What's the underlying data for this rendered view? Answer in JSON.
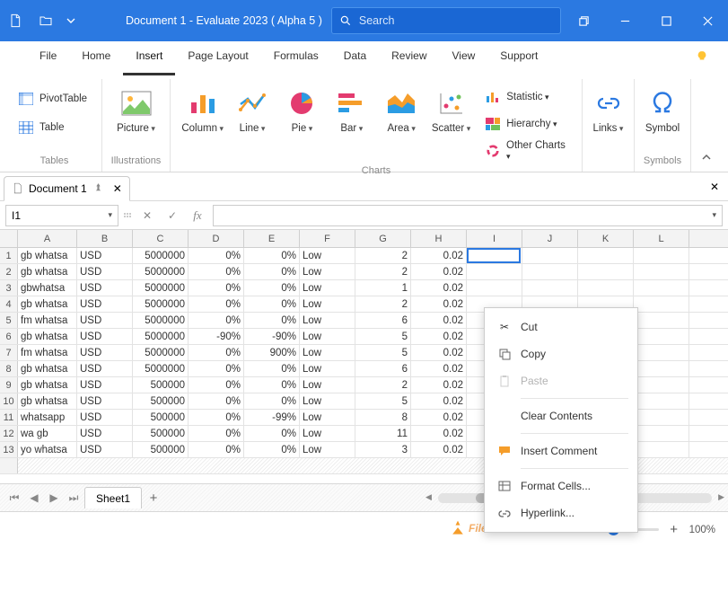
{
  "titlebar": {
    "document_title": "Document 1 - Evaluate 2023 ( Alpha 5 )",
    "search_placeholder": "Search"
  },
  "menu": {
    "tabs": [
      "File",
      "Home",
      "Insert",
      "Page Layout",
      "Formulas",
      "Data",
      "Review",
      "View",
      "Support"
    ],
    "active": "Insert"
  },
  "ribbon": {
    "tables": {
      "label": "Tables",
      "pivot": "PivotTable",
      "table": "Table"
    },
    "illustrations": {
      "label": "Illustrations",
      "picture": "Picture"
    },
    "charts": {
      "label": "Charts",
      "column": "Column",
      "line": "Line",
      "pie": "Pie",
      "bar": "Bar",
      "area": "Area",
      "scatter": "Scatter",
      "statistic": "Statistic",
      "hierarchy": "Hierarchy",
      "other": "Other Charts"
    },
    "links": {
      "label": "",
      "links": "Links"
    },
    "symbols": {
      "label": "Symbols",
      "symbol": "Symbol"
    }
  },
  "doctab": {
    "name": "Document 1"
  },
  "formula": {
    "cellref": "I1"
  },
  "grid": {
    "cols": [
      "A",
      "B",
      "C",
      "D",
      "E",
      "F",
      "G",
      "H",
      "I",
      "J",
      "K",
      "L"
    ],
    "rows": [
      {
        "n": "1",
        "A": "gb whatsa",
        "B": "USD",
        "C": "5000000",
        "D": "0%",
        "E": "0%",
        "F": "Low",
        "G": "2",
        "H": "0.02"
      },
      {
        "n": "2",
        "A": "gb whatsa",
        "B": "USD",
        "C": "5000000",
        "D": "0%",
        "E": "0%",
        "F": "Low",
        "G": "2",
        "H": "0.02"
      },
      {
        "n": "3",
        "A": "gbwhatsa",
        "B": "USD",
        "C": "5000000",
        "D": "0%",
        "E": "0%",
        "F": "Low",
        "G": "1",
        "H": "0.02"
      },
      {
        "n": "4",
        "A": "gb whatsa",
        "B": "USD",
        "C": "5000000",
        "D": "0%",
        "E": "0%",
        "F": "Low",
        "G": "2",
        "H": "0.02"
      },
      {
        "n": "5",
        "A": "fm whatsa",
        "B": "USD",
        "C": "5000000",
        "D": "0%",
        "E": "0%",
        "F": "Low",
        "G": "6",
        "H": "0.02"
      },
      {
        "n": "6",
        "A": "gb whatsa",
        "B": "USD",
        "C": "5000000",
        "D": "-90%",
        "E": "-90%",
        "F": "Low",
        "G": "5",
        "H": "0.02"
      },
      {
        "n": "7",
        "A": "fm whatsa",
        "B": "USD",
        "C": "5000000",
        "D": "0%",
        "E": "900%",
        "F": "Low",
        "G": "5",
        "H": "0.02"
      },
      {
        "n": "8",
        "A": "gb whatsa",
        "B": "USD",
        "C": "5000000",
        "D": "0%",
        "E": "0%",
        "F": "Low",
        "G": "6",
        "H": "0.02"
      },
      {
        "n": "9",
        "A": "gb whatsa",
        "B": "USD",
        "C": "500000",
        "D": "0%",
        "E": "0%",
        "F": "Low",
        "G": "2",
        "H": "0.02"
      },
      {
        "n": "10",
        "A": "gb whatsa",
        "B": "USD",
        "C": "500000",
        "D": "0%",
        "E": "0%",
        "F": "Low",
        "G": "5",
        "H": "0.02"
      },
      {
        "n": "11",
        "A": "whatsapp",
        "B": "USD",
        "C": "500000",
        "D": "0%",
        "E": "-99%",
        "F": "Low",
        "G": "8",
        "H": "0.02"
      },
      {
        "n": "12",
        "A": "wa gb",
        "B": "USD",
        "C": "500000",
        "D": "0%",
        "E": "0%",
        "F": "Low",
        "G": "11",
        "H": "0.02"
      },
      {
        "n": "13",
        "A": "yo whatsa",
        "B": "USD",
        "C": "500000",
        "D": "0%",
        "E": "0%",
        "F": "Low",
        "G": "3",
        "H": "0.02"
      }
    ]
  },
  "contextmenu": {
    "cut": "Cut",
    "copy": "Copy",
    "paste": "Paste",
    "clear": "Clear Contents",
    "comment": "Insert Comment",
    "format": "Format Cells...",
    "hyperlink": "Hyperlink..."
  },
  "sheets": {
    "sheet1": "Sheet1"
  },
  "status": {
    "zoom": "100%"
  },
  "watermark": "FileOur.com"
}
